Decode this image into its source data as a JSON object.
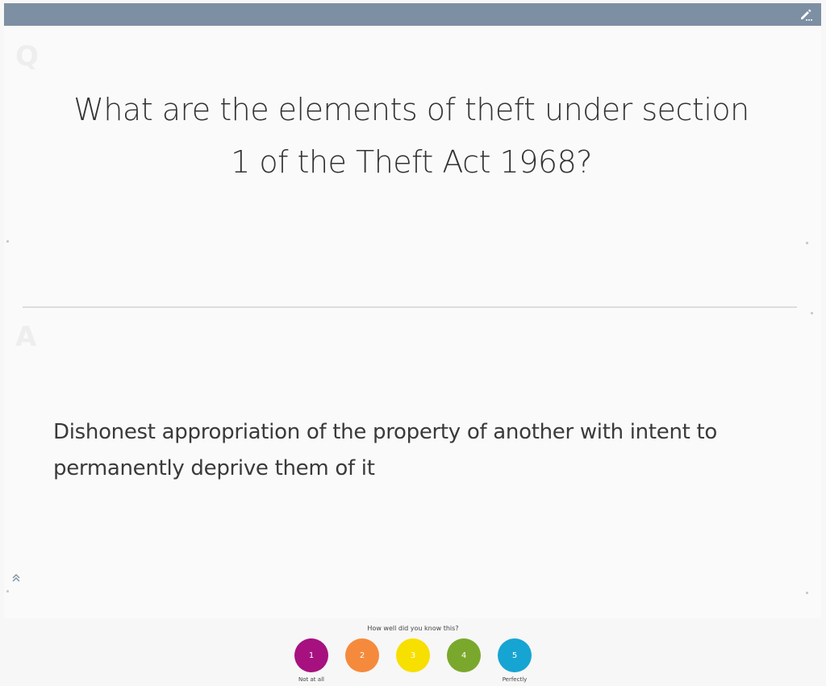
{
  "header": {
    "edit_icon": "pencil-icon",
    "bar_color": "#7d8fa3"
  },
  "card": {
    "question_marker": "Q",
    "question": "What are the elements of theft under section 1 of the Theft Act 1968?",
    "answer_marker": "A",
    "answer": "Dishonest appropriation of the property of another with intent to permanently deprive them of it",
    "collapse_icon": "double-chevron-up-icon"
  },
  "rating": {
    "prompt": "How well did you know this?",
    "options": [
      {
        "label": "1",
        "color": "#a6117f"
      },
      {
        "label": "2",
        "color": "#f58a3d"
      },
      {
        "label": "3",
        "color": "#f7df00"
      },
      {
        "label": "4",
        "color": "#7aa82c"
      },
      {
        "label": "5",
        "color": "#16a4d3"
      }
    ],
    "low_label": "Not at all",
    "high_label": "Perfectly"
  }
}
